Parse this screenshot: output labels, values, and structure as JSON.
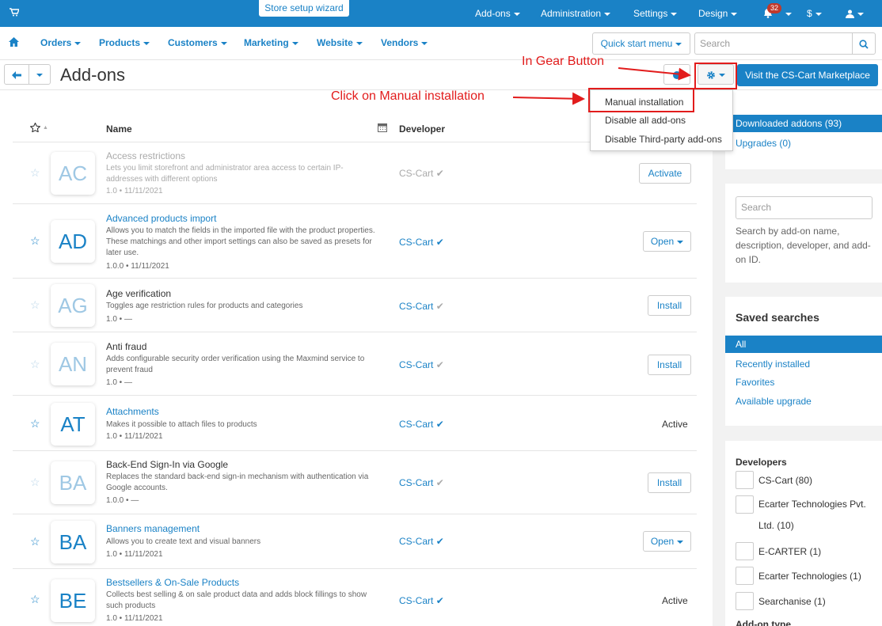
{
  "topbar": {
    "wizard": "Store setup wizard",
    "items": [
      "Add-ons",
      "Administration",
      "Settings",
      "Design"
    ],
    "notif_count": "32",
    "currency": "$"
  },
  "subnav": {
    "items": [
      "Orders",
      "Products",
      "Customers",
      "Marketing",
      "Website",
      "Vendors"
    ],
    "quick_start": "Quick start menu",
    "search_placeholder": "Search"
  },
  "titlebar": {
    "title": "Add-ons",
    "marketplace": "Visit the CS-Cart Marketplace"
  },
  "dropdown": [
    "Manual installation",
    "Disable all add-ons",
    "Disable Third-party add-ons"
  ],
  "annotations": {
    "gear": "In Gear Button",
    "manual": "Click on Manual installation",
    "color": "#e21c1c"
  },
  "table": {
    "col_name": "Name",
    "col_developer": "Developer",
    "rows": [
      {
        "abbr": "AC",
        "name": "Access restrictions",
        "desc": "Lets you limit storefront and administrator area access to certain IP-addresses with different options",
        "version": "1.0 • 11/11/2021",
        "developer": "CS-Cart",
        "action": "Activate"
      },
      {
        "abbr": "AD",
        "name": "Advanced products import",
        "desc": "Allows you to match the fields in the imported file with the product properties. These matchings and other import settings can also be saved as presets for later use.",
        "version": "1.0.0 • 11/11/2021",
        "developer": "CS-Cart",
        "action": "Open"
      },
      {
        "abbr": "AG",
        "name": "Age verification",
        "desc": "Toggles age restriction rules for products and categories",
        "version": "1.0 • —",
        "developer": "CS-Cart",
        "action": "Install"
      },
      {
        "abbr": "AN",
        "name": "Anti fraud",
        "desc": "Adds configurable security order verification using the Maxmind service to prevent fraud",
        "version": "1.0 • —",
        "developer": "CS-Cart",
        "action": "Install"
      },
      {
        "abbr": "AT",
        "name": "Attachments",
        "desc": "Makes it possible to attach files to products",
        "version": "1.0 • 11/11/2021",
        "developer": "CS-Cart",
        "action": "Active"
      },
      {
        "abbr": "BA",
        "name": "Back-End Sign-In via Google",
        "desc": "Replaces the standard back-end sign-in mechanism with authentication via Google accounts.",
        "version": "1.0.0 • —",
        "developer": "CS-Cart",
        "action": "Install"
      },
      {
        "abbr": "BA",
        "name": "Banners management",
        "desc": "Allows you to create text and visual banners",
        "version": "1.0 • 11/11/2021",
        "developer": "CS-Cart",
        "action": "Open"
      },
      {
        "abbr": "BE",
        "name": "Bestsellers & On-Sale Products",
        "desc": "Collects best selling & on sale product data and adds block fillings to show such products",
        "version": "1.0 • 11/11/2021",
        "developer": "CS-Cart",
        "action": "Active"
      }
    ]
  },
  "sidebar": {
    "tabs": [
      "Downloaded addons (93)",
      "Upgrades (0)"
    ],
    "search_placeholder": "Search",
    "search_hint": "Search by add-on name, description, developer, and add-on ID.",
    "saved_title": "Saved searches",
    "saved": [
      "All",
      "Recently installed",
      "Favorites",
      "Available upgrade"
    ],
    "dev_title": "Developers",
    "developers": [
      "CS-Cart (80)",
      "Ecarter Technologies Pvt. Ltd. (10)",
      "E-CARTER (1)",
      "Ecarter Technologies (1)",
      "Searchanise (1)"
    ],
    "addon_type_title": "Add-on type"
  }
}
